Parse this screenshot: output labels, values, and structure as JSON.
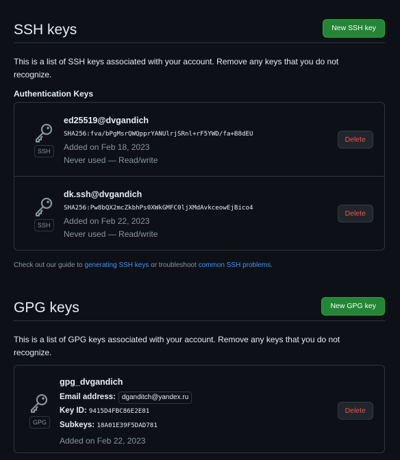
{
  "ssh": {
    "title": "SSH keys",
    "new_button": "New SSH key",
    "description": "This is a list of SSH keys associated with your account. Remove any keys that you do not recognize.",
    "auth_heading": "Authentication Keys",
    "keys": [
      {
        "name": "ed25519@dvgandich",
        "fingerprint": "SHA256:fva/bPgMsrQWQpprYANUlrjSRnl+rF5YWD/fa+B8dEU",
        "added": "Added on Feb 18, 2023",
        "usage": "Never used — Read/write",
        "badge": "SSH",
        "delete_label": "Delete"
      },
      {
        "name": "dk.ssh@dvgandich",
        "fingerprint": "SHA256:Pw8bQX2mcZkbhPs0XWkGMFC0ljXMdAvkceowEjBico4",
        "added": "Added on Feb 22, 2023",
        "usage": "Never used — Read/write",
        "badge": "SSH",
        "delete_label": "Delete"
      }
    ],
    "guide": {
      "prefix": "Check out our guide to ",
      "link1": "generating SSH keys",
      "middle": " or troubleshoot ",
      "link2": "common SSH problems",
      "suffix": "."
    }
  },
  "gpg": {
    "title": "GPG keys",
    "new_button": "New GPG key",
    "description": "This is a list of GPG keys associated with your account. Remove any keys that you do not recognize.",
    "key": {
      "name": "gpg_dvgandich",
      "email_label": "Email address:",
      "email": "dganditch@yandex.ru",
      "keyid_label": "Key ID:",
      "keyid": "9415D4FBC86E2E81",
      "subkeys_label": "Subkeys:",
      "subkeys": "18A01E39F5DAD781",
      "added": "Added on Feb 22, 2023",
      "badge": "GPG",
      "delete_label": "Delete"
    }
  },
  "icons": {
    "key": "key-icon"
  },
  "colors": {
    "accent_green": "#238636",
    "danger": "#f85149",
    "link": "#4493f8",
    "background": "#0d1117"
  }
}
